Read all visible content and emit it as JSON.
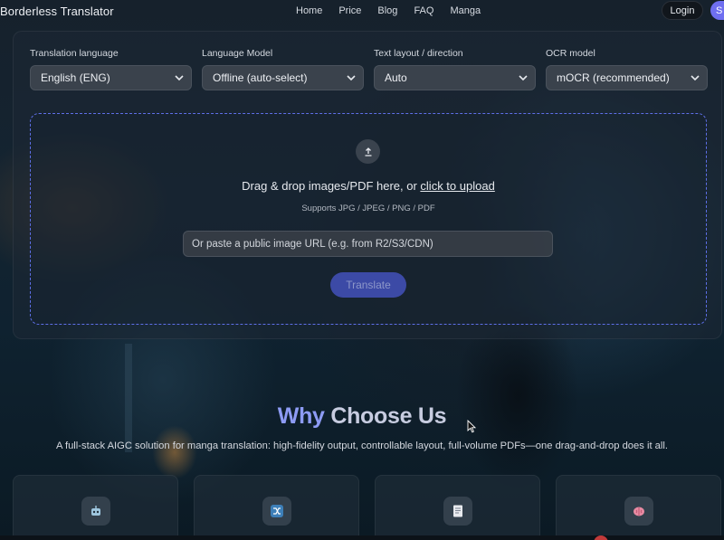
{
  "header": {
    "brand": "Borderless Translator",
    "nav": [
      {
        "label": "Home"
      },
      {
        "label": "Price"
      },
      {
        "label": "Blog"
      },
      {
        "label": "FAQ"
      },
      {
        "label": "Manga"
      }
    ],
    "login_label": "Login",
    "signup_label": "S"
  },
  "settings": {
    "translation_language": {
      "label": "Translation language",
      "value": "English (ENG)"
    },
    "language_model": {
      "label": "Language Model",
      "value": "Offline (auto-select)"
    },
    "text_layout": {
      "label": "Text layout / direction",
      "value": "Auto"
    },
    "ocr_model": {
      "label": "OCR model",
      "value": "mOCR (recommended)"
    }
  },
  "upload": {
    "drop_prefix": "Drag & drop images/PDF here, or ",
    "drop_link": "click to upload",
    "supports": "Supports JPG / JPEG / PNG / PDF",
    "url_placeholder": "Or paste a public image URL (e.g. from R2/S3/CDN)",
    "translate_label": "Translate"
  },
  "why": {
    "title_part1": "Why",
    "title_part2": "Choose Us",
    "subtitle": "A full-stack AIGC solution for manga translation: high-fidelity output, controllable layout, full-volume PDFs—one drag-and-drop does it all."
  },
  "features": [
    {
      "icon": "robot-icon"
    },
    {
      "icon": "shuffle-icon"
    },
    {
      "icon": "document-icon"
    },
    {
      "icon": "brain-icon"
    }
  ],
  "colors": {
    "accent": "#6f6ff0",
    "dropzone_border": "#5e6fe8",
    "translate_button": "#3c4aa6",
    "title_highlight": "#8d9bf4"
  }
}
